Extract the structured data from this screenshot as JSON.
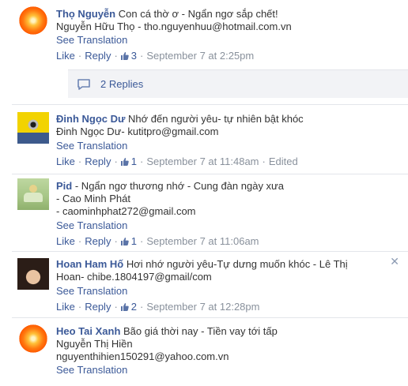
{
  "comments": [
    {
      "author": "Thọ Nguyễn",
      "lines": [
        "Con cá thờ ơ - Ngẩn ngơ sắp chết!",
        "Nguyễn Hữu Thọ - tho.nguyenhuu@hotmail.com.vn"
      ],
      "see_translation": "See Translation",
      "like": "Like",
      "reply": "Reply",
      "likes": "3",
      "timestamp": "September 7 at 2:25pm",
      "replies_label": "2 Replies"
    },
    {
      "author": "Đinh Ngọc Dư",
      "lines": [
        "Nhớ đến người yêu- tự nhiên bật khóc",
        "Đinh Ngọc Dư- kutitpro@gmail.com"
      ],
      "see_translation": "See Translation",
      "like": "Like",
      "reply": "Reply",
      "likes": "1",
      "timestamp": "September 7 at 11:48am",
      "edited": "Edited"
    },
    {
      "author": "Pid",
      "lines": [
        "- Ngẩn ngơ thương nhớ - Cung đàn ngày xưa",
        "- Cao Minh Phát",
        "- caominhphat272@gmail.com"
      ],
      "see_translation": "See Translation",
      "like": "Like",
      "reply": "Reply",
      "likes": "1",
      "timestamp": "September 7 at 11:06am"
    },
    {
      "author": "Hoan Ham Hố",
      "lines": [
        "Hơi nhớ người yêu-Tự dưng muốn khóc - Lê Thị",
        "Hoan- chibe.1804197@gmail/com"
      ],
      "see_translation": "See Translation",
      "like": "Like",
      "reply": "Reply",
      "likes": "2",
      "timestamp": "September 7 at 12:28pm",
      "close_glyph": "✕"
    },
    {
      "author": "Heo Tai Xanh",
      "lines": [
        "Bão giá thời nay - Tiền vay tới tấp",
        "Nguyễn Thị Hiền",
        "nguyenthihien150291@yahoo.com.vn"
      ],
      "see_translation": "See Translation"
    }
  ],
  "colors": {
    "link": "#3b5998",
    "meta": "#89919c",
    "reply_bg": "#f2f3f6"
  }
}
